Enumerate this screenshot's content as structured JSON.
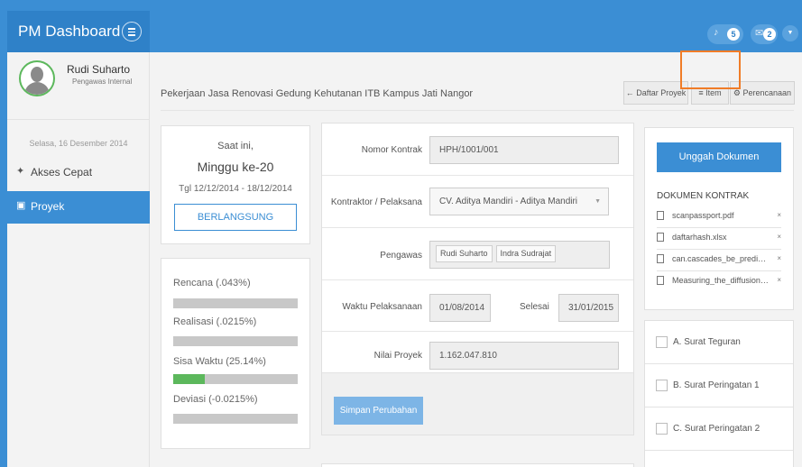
{
  "app": {
    "title": "PM Dashboard"
  },
  "topbar": {
    "notif_count": "5",
    "mail_count": "2",
    "user_menu_caret": "▼"
  },
  "sidebar": {
    "user": {
      "name": "Rudi Suharto",
      "role": "Pengawas Internal"
    },
    "date": "Selasa, 16 Desember 2014",
    "items": [
      {
        "label": "Akses Cepat",
        "icon": "magic-wand-icon",
        "active": false
      },
      {
        "label": "Proyek",
        "icon": "briefcase-icon",
        "active": true
      }
    ]
  },
  "header": {
    "project_title": "Pekerjaan Jasa Renovasi Gedung Kehutanan ITB Kampus Jati Nangor",
    "nav": {
      "back_label": "Daftar Proyek",
      "item_label": "Item",
      "plan_label": "Perencanaan"
    }
  },
  "status": {
    "now_label": "Saat ini,",
    "week": "Minggu ke-20",
    "range": "Tgl 12/12/2014 - 18/12/2014",
    "state": "BERLANGSUNG"
  },
  "progress": [
    {
      "label": "Rencana (.043%)",
      "value_percent": 0.043
    },
    {
      "label": "Realisasi (.0215%)",
      "value_percent": 0.0215
    },
    {
      "label": "Sisa Waktu (25.14%)",
      "value_percent": 25.14
    },
    {
      "label": "Deviasi (-0.0215%)",
      "value_percent": 0
    }
  ],
  "form": {
    "contract_label": "Nomor Kontrak",
    "contract_value": "HPH/1001/001",
    "contractor_label": "Kontraktor / Pelaksana",
    "contractor_value": "CV. Aditya Mandiri - Aditya Mandiri",
    "supervisor_label": "Pengawas",
    "supervisors": [
      "Rudi Suharto",
      "Indra Sudrajat"
    ],
    "period_label": "Waktu Pelaksanaan",
    "start_date": "01/08/2014",
    "end_label": "Selesai",
    "end_date": "31/01/2015",
    "value_label": "Nilai Proyek",
    "value": "1.162.047.810",
    "save_label": "Simpan Perubahan"
  },
  "documents": {
    "upload_label": "Unggah Dokumen",
    "heading": "DOKUMEN KONTRAK",
    "files": [
      "scanpassport.pdf",
      "daftarhash.xlsx",
      "can.cascades_be_predicte...",
      "Measuring_the_diffusion_of..."
    ],
    "remove_symbol": "×"
  },
  "letters": [
    "A. Surat Teguran",
    "B. Surat Peringatan 1",
    "C. Surat Peringatan 2"
  ],
  "colors": {
    "primary": "#3b8ed4",
    "success": "#5cb85c",
    "highlight": "#f07c27"
  }
}
